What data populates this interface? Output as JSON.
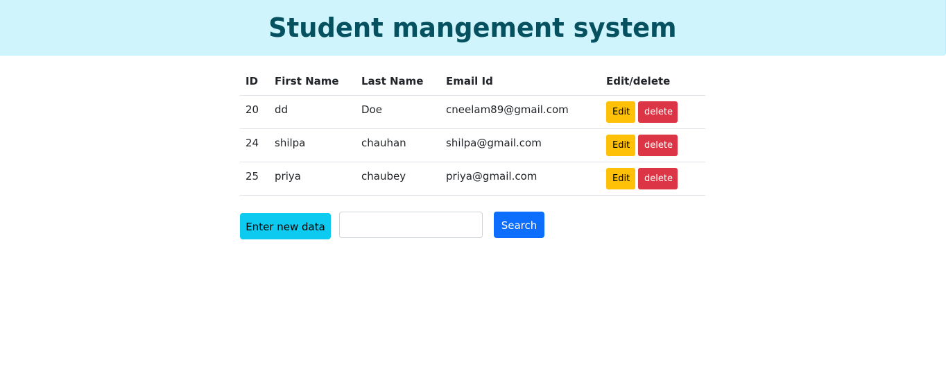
{
  "header": {
    "title": "Student mangement system"
  },
  "table": {
    "columns": [
      "ID",
      "First Name",
      "Last Name",
      "Email Id",
      "Edit/delete"
    ],
    "rows": [
      {
        "id": "20",
        "first_name": "dd",
        "last_name": "Doe",
        "email": "cneelam89@gmail.com",
        "edit_label": "Edit",
        "delete_label": "delete"
      },
      {
        "id": "24",
        "first_name": "shilpa",
        "last_name": "chauhan",
        "email": "shilpa@gmail.com",
        "edit_label": "Edit",
        "delete_label": "delete"
      },
      {
        "id": "25",
        "first_name": "priya",
        "last_name": "chaubey",
        "email": "priya@gmail.com",
        "edit_label": "Edit",
        "delete_label": "delete"
      }
    ]
  },
  "actions": {
    "new_data_label": "Enter new data",
    "search_value": "",
    "search_placeholder": "",
    "search_label": "Search"
  },
  "colors": {
    "header_bg": "#cff4fc",
    "header_text": "#055160",
    "edit_button": "#ffc107",
    "delete_button": "#dc3545",
    "new_data_button": "#0dcaf0",
    "search_button": "#0d6efd"
  }
}
